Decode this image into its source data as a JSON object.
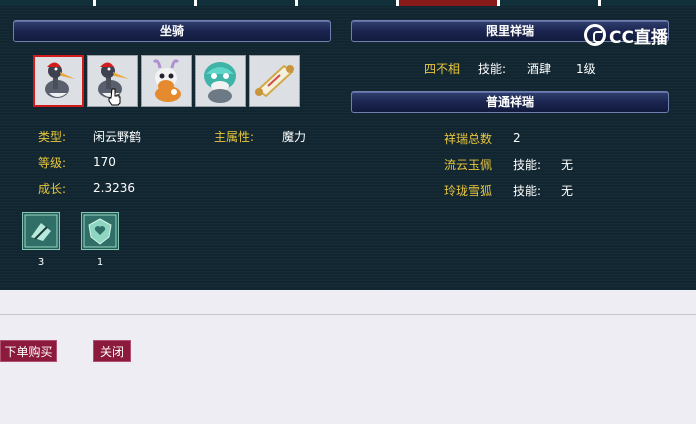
{
  "left_panel": {
    "header": "坐骑",
    "mounts": [
      {
        "icon": "crane-mount-icon",
        "selected": true
      },
      {
        "icon": "crane-mount-icon",
        "selected": false
      },
      {
        "icon": "deer-mount-icon",
        "selected": false
      },
      {
        "icon": "teal-creature-mount-icon",
        "selected": false
      },
      {
        "icon": "scroll-mount-icon",
        "selected": false
      }
    ],
    "type_label": "类型:",
    "type_value": "闲云野鹤",
    "attr_label": "主属性:",
    "attr_value": "魔力",
    "level_label": "等级:",
    "level_value": "170",
    "growth_label": "成长:",
    "growth_value": "2.3236",
    "skills": [
      {
        "icon": "mount-skill-icon",
        "count": "3"
      },
      {
        "icon": "shield-heart-skill-icon",
        "count": "1"
      }
    ]
  },
  "right_panel": {
    "limited_header": "限里祥瑞",
    "limited_item": {
      "name": "四不相",
      "skill_label": "技能:",
      "skill_value": "酒肆",
      "level": "1级"
    },
    "normal_header": "普通祥瑞",
    "total_label": "祥瑞总数",
    "total_value": "2",
    "items": [
      {
        "name": "流云玉佩",
        "skill_label": "技能:",
        "skill_value": "无"
      },
      {
        "name": "玲珑雪狐",
        "skill_label": "技能:",
        "skill_value": "无"
      }
    ]
  },
  "logo": {
    "text": "CC直播"
  },
  "actions": {
    "order_label": "下单购买",
    "close_label": "关闭"
  },
  "colors": {
    "label_gold": "#e9c63c",
    "selected_border": "#d11a1a",
    "button_bg": "#8c1a3d",
    "active_tab": "#8b1b1b"
  }
}
